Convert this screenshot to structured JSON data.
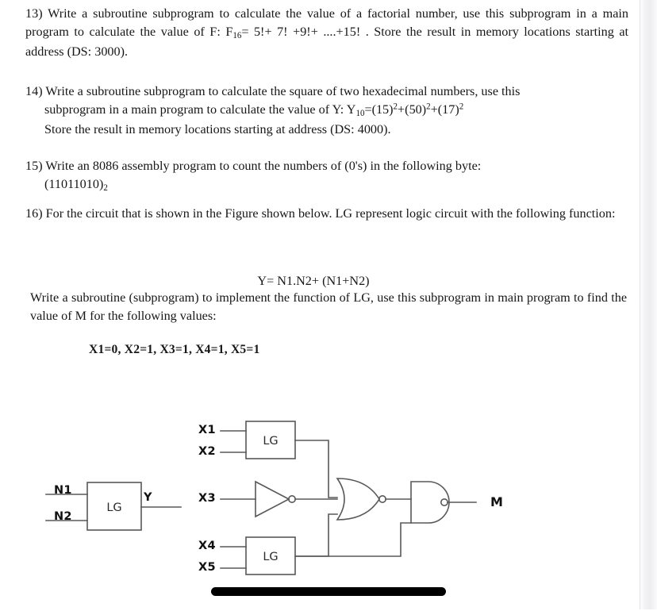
{
  "document": {
    "questions": [
      {
        "id": "q13",
        "number": "13)",
        "line1": "Write a subroutine subprogram to calculate the value of a factorial number, use this",
        "line2_pre": "subprogram in a main program to calculate the value of F: F",
        "line2_sub": "16",
        "line2_post": "= 5!+ 7! +9!+ ....+15! . Store the",
        "line3": "result in memory locations starting at address (DS: 3000)."
      },
      {
        "id": "q14",
        "number": "14)",
        "line1": "Write a subroutine subprogram to calculate the square of two hexadecimal numbers, use this",
        "line2_pre": "subprogram in a main program to calculate the value of Y:   Y",
        "line2_sub": "10",
        "line2_post": "=(15)",
        "line2_sup1": "2",
        "line2_mid1": "+(50)",
        "line2_sup2": "2",
        "line2_mid2": "+(17)",
        "line2_sup3": "2",
        "line3": "Store the result in memory locations starting at address (DS: 4000)."
      },
      {
        "id": "q15",
        "number": "15)",
        "line1": "Write an 8086 assembly program to count the numbers of (0's) in the following byte:",
        "line2_pre": "(11011010)",
        "line2_sub": "2"
      },
      {
        "id": "q16",
        "number": "16)",
        "line1": "For the circuit that is shown in the Figure shown below. LG represent logic circuit with the",
        "line2": "following function:",
        "formula": "Y= N1.N2+ (N1+N2)",
        "body1": "Write a subroutine (subprogram) to implement the function of LG, use this subprogram in main",
        "body2": "program to find the value of M for the following values:",
        "values": "X1=0, X2=1, X3=1, X4=1, X5=1"
      }
    ]
  },
  "figure": {
    "name": "logic-circuit-diagram",
    "lg_block_label": "LG",
    "reference_gate": {
      "inputs": [
        "N1",
        "N2"
      ],
      "output": "Y",
      "label": "LG"
    },
    "main_circuit": {
      "inputs": [
        "X1",
        "X2",
        "X3",
        "X4",
        "X5"
      ],
      "output": "M",
      "blocks": [
        {
          "label": "LG",
          "inputs": [
            "X1",
            "X2"
          ]
        },
        {
          "label": "NOT",
          "inputs": [
            "X3"
          ]
        },
        {
          "label": "LG",
          "inputs": [
            "X4",
            "X5"
          ]
        },
        {
          "label": "NOR",
          "inputs": [
            "LG1",
            "NOT",
            "LG2"
          ]
        },
        {
          "label": "NAND",
          "inputs": [
            "NOR",
            "LG2"
          ]
        }
      ]
    }
  },
  "annotation": {
    "redaction_bar": "black-bar"
  },
  "colors": {
    "page_background": "#ffffff",
    "text": "#171717",
    "wire": "#585858",
    "bar": "#000000"
  }
}
